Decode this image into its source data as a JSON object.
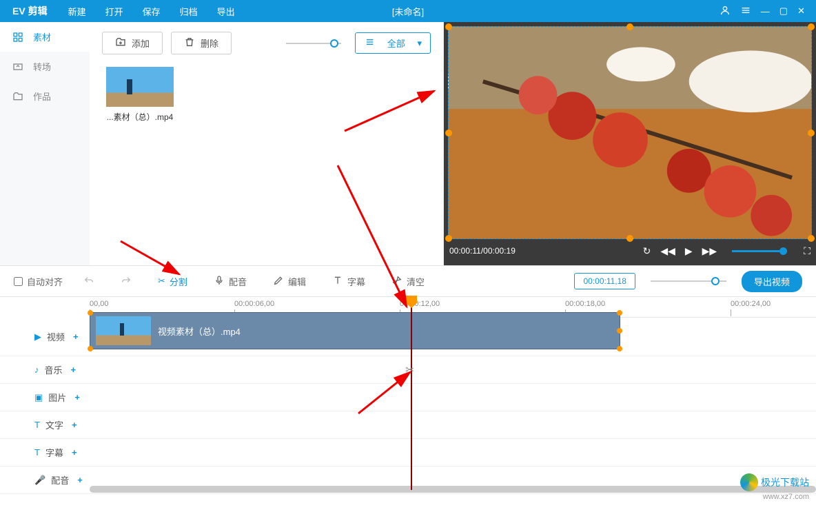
{
  "app": {
    "title": "EV 剪辑",
    "project": "[未命名]"
  },
  "menu": {
    "new": "新建",
    "open": "打开",
    "save": "保存",
    "archive": "归档",
    "export": "导出"
  },
  "sidebar": {
    "items": [
      {
        "label": "素材"
      },
      {
        "label": "转场"
      },
      {
        "label": "作品"
      }
    ]
  },
  "media": {
    "add": "添加",
    "delete": "删除",
    "filter": "全部",
    "clip_name": "...素材（总）.mp4"
  },
  "preview": {
    "time": "00:00:11/00:00:19"
  },
  "toolbar": {
    "auto_align": "自动对齐",
    "split": "分割",
    "dub": "配音",
    "edit": "编辑",
    "subtitle": "字幕",
    "clear": "清空",
    "timecode": "00:00:11,18",
    "export": "导出视频"
  },
  "ruler": {
    "marks": [
      "00,00",
      "00:00:06,00",
      "00:00:12,00",
      "00:00:18,00",
      "00:00:24,00"
    ]
  },
  "tracks": {
    "video": "视频",
    "music": "音乐",
    "image": "图片",
    "text": "文字",
    "subtitle": "字幕",
    "dub": "配音",
    "clip_name": "视频素材（总）.mp4"
  },
  "watermark": {
    "name": "极光下载站",
    "url": "www.xz7.com"
  }
}
